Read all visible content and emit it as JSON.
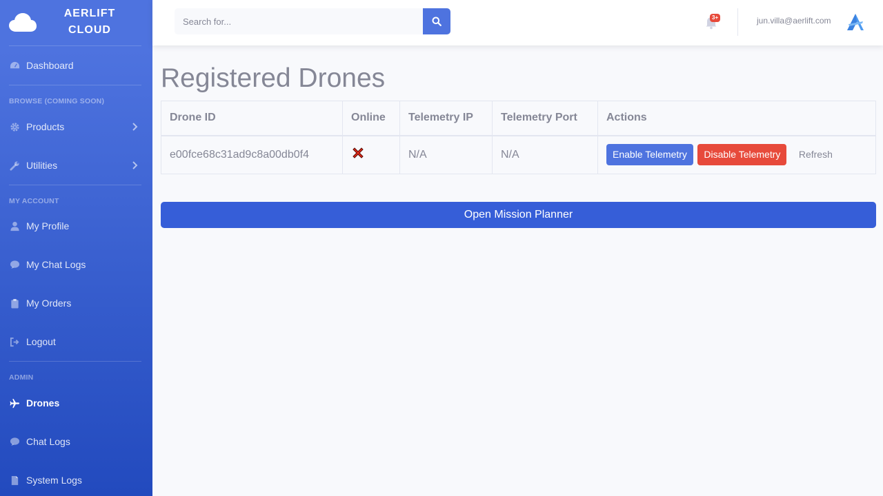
{
  "sidebar": {
    "brand_line1": "AERLIFT",
    "brand_line2": "CLOUD",
    "dashboard": "Dashboard",
    "heading_browse": "BROWSE (COMING SOON)",
    "products": "Products",
    "utilities": "Utilities",
    "heading_account": "MY ACCOUNT",
    "my_profile": "My Profile",
    "my_chat_logs": "My Chat Logs",
    "my_orders": "My Orders",
    "logout": "Logout",
    "heading_admin": "ADMIN",
    "drones": "Drones",
    "chat_logs": "Chat Logs",
    "system_logs": "System Logs"
  },
  "topbar": {
    "search_placeholder": "Search for...",
    "alerts_badge": "3+",
    "user_email": "jun.villa@aerlift.com"
  },
  "main": {
    "title": "Registered Drones",
    "columns": [
      "Drone ID",
      "Online",
      "Telemetry IP",
      "Telemetry Port",
      "Actions"
    ],
    "rows": [
      {
        "drone_id": "e00fce68c31ad9c8a00db0f4",
        "online_icon": "red-x-icon",
        "telemetry_ip": "N/A",
        "telemetry_port": "N/A"
      }
    ],
    "actions": {
      "enable": "Enable Telemetry",
      "disable": "Disable Telemetry",
      "refresh": "Refresh"
    },
    "mission_button": "Open Mission Planner"
  },
  "colors": {
    "primary": "#4e73df",
    "danger": "#e74a3b",
    "sidebar_bottom": "#224abe"
  }
}
